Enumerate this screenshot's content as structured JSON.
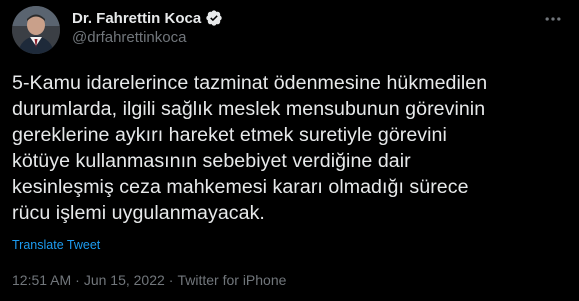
{
  "author": {
    "display_name": "Dr. Fahrettin Koca",
    "handle": "@drfahrettinkoca",
    "verified": true
  },
  "tweet": {
    "text": "5-Kamu idarelerince tazminat ödenmesine hükmedilen\ndurumlarda, ilgili sağlık meslek mensubunun görevinin\ngereklerine aykırı hareket etmek suretiyle görevini\nkötüye kullanmasının sebebiyet verdiğine dair\nkesinleşmiş ceza mahkemesi kararı olmadığı sürece\nrücu işlemi uygulanmayacak.",
    "translate_label": "Translate Tweet",
    "time": "12:51 AM",
    "separator": "·",
    "date": "Jun 15, 2022",
    "source": "Twitter for iPhone"
  },
  "icons": {
    "verified": "verified-badge-icon",
    "more": "more-options-icon"
  },
  "colors": {
    "background": "#000000",
    "text": "#e7e9ea",
    "secondary": "#71767b",
    "accent": "#1d9bf0"
  }
}
